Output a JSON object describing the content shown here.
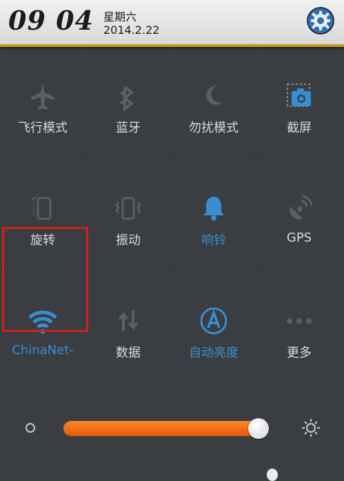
{
  "status": {
    "time": "09 04",
    "weekday": "星期六",
    "date": "2014.2.22"
  },
  "toggles": [
    {
      "label": "飞行模式",
      "icon": "airplane-icon",
      "state": "off"
    },
    {
      "label": "蓝牙",
      "icon": "bluetooth-icon",
      "state": "off"
    },
    {
      "label": "勿扰模式",
      "icon": "moon-icon",
      "state": "off"
    },
    {
      "label": "截屏",
      "icon": "screenshot-camera-icon",
      "state": "on"
    },
    {
      "label": "旋转",
      "icon": "rotate-phone-icon",
      "state": "off"
    },
    {
      "label": "振动",
      "icon": "vibrate-icon",
      "state": "off"
    },
    {
      "label": "响铃",
      "icon": "bell-icon",
      "state": "on"
    },
    {
      "label": "GPS",
      "icon": "gps-satellite-icon",
      "state": "off"
    },
    {
      "label": "ChinaNet-",
      "icon": "wifi-icon",
      "state": "on"
    },
    {
      "label": "数据",
      "icon": "data-arrows-icon",
      "state": "off"
    },
    {
      "label": "自动亮度",
      "icon": "auto-brightness-icon",
      "state": "on"
    },
    {
      "label": "更多",
      "icon": "more-dots-icon",
      "state": "off"
    }
  ],
  "brightness": {
    "level": 0.95
  },
  "colors": {
    "accent_blue": "#3a8ed0",
    "slider_orange": "#f47a1f",
    "highlight_red": "#d02020",
    "header_gold": "#c79a1c"
  }
}
